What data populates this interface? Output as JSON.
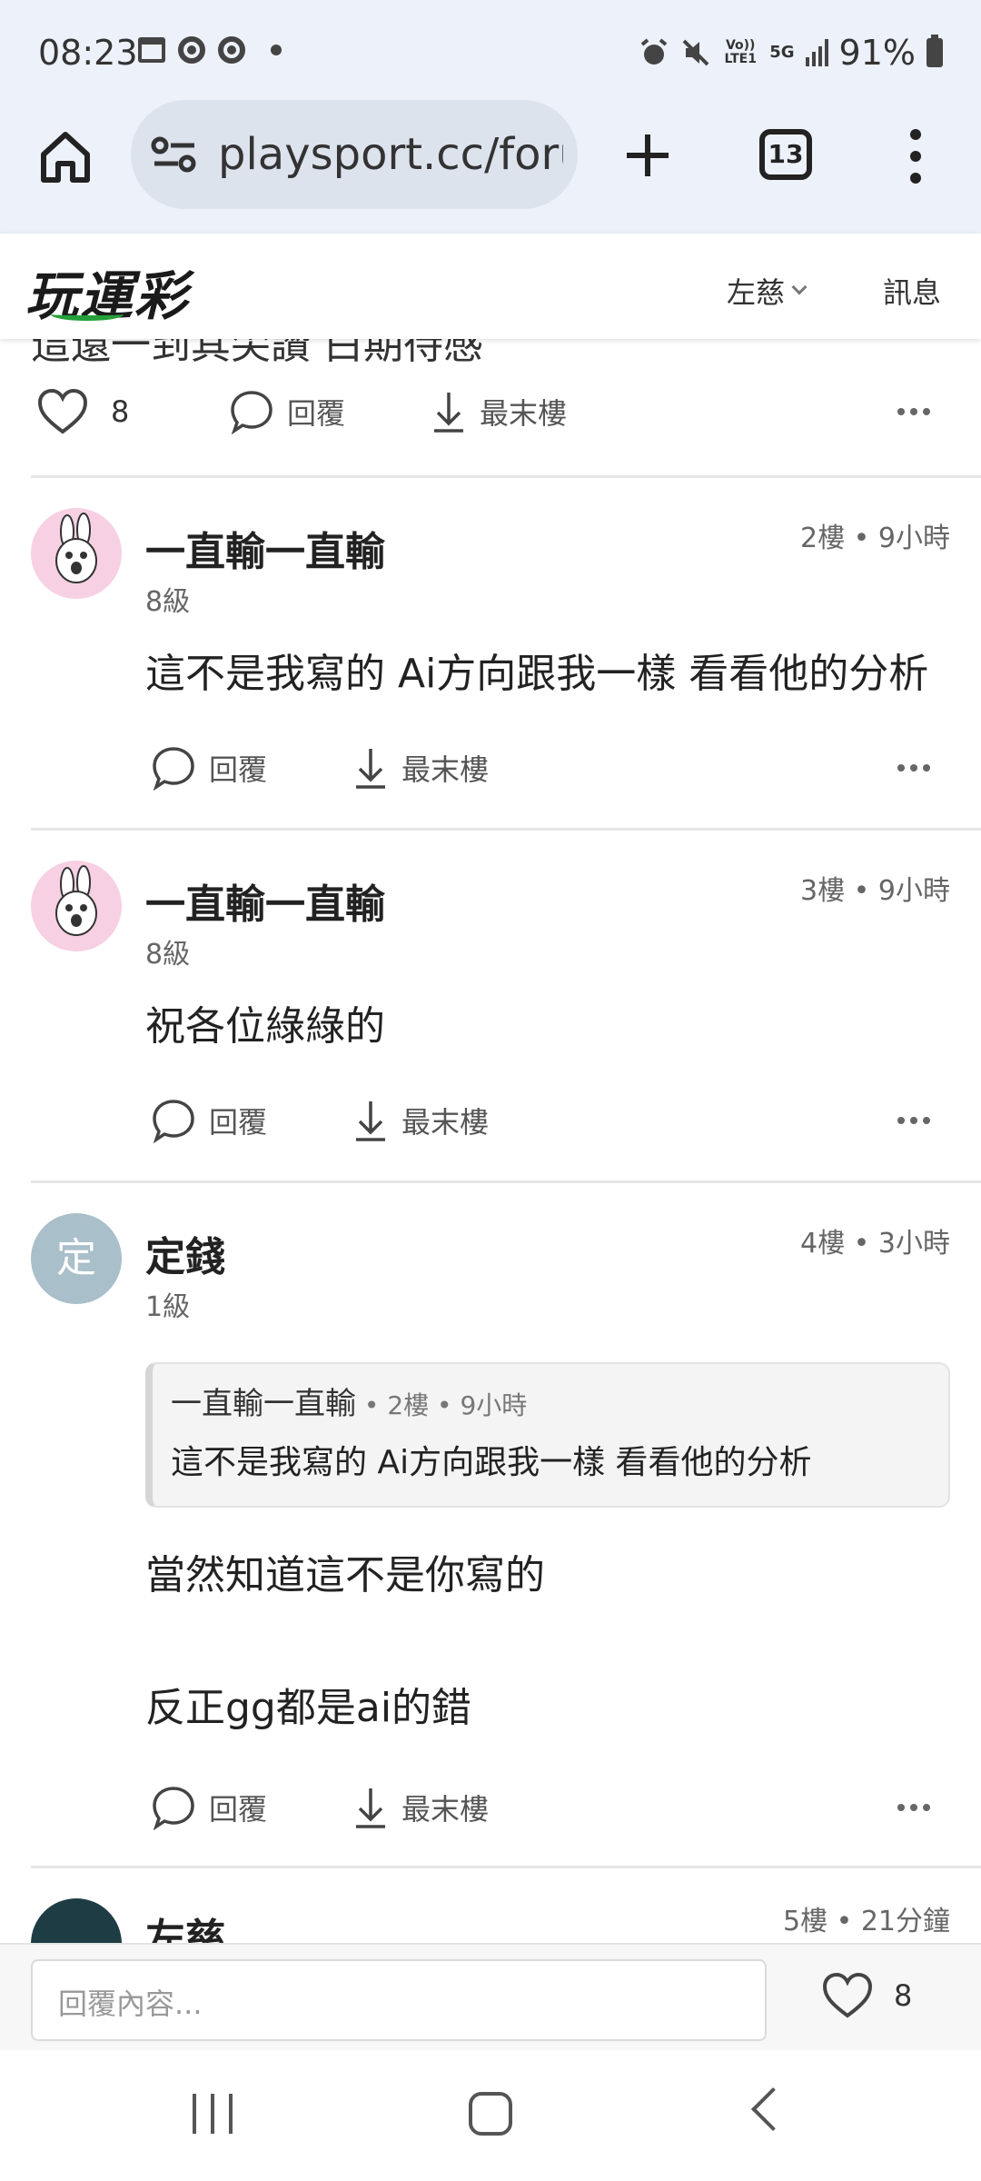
{
  "status_bar": {
    "time": "08:23",
    "battery": "91%",
    "network": "5G",
    "volte": "Vo)) LTE1",
    "icons_left": [
      "calendar-icon",
      "chrome-icon",
      "chrome-icon",
      "dot-icon"
    ],
    "icons_right": [
      "alarm-icon",
      "mute-icon",
      "volte-icon",
      "5g-icon",
      "signal-icon",
      "battery-icon"
    ]
  },
  "browser": {
    "url": "playsport.cc/foru",
    "tab_count": "13"
  },
  "site_header": {
    "logo": "玩運彩",
    "user": "左慈",
    "messages": "訊息"
  },
  "content": {
    "truncated_top_text": "這還一到其尖讚 白期待感",
    "first_post_actions": {
      "like_count": "8",
      "reply": "回覆",
      "last_floor": "最末樓"
    },
    "posts": [
      {
        "username": "一直輸一直輸",
        "level": "8級",
        "floor_time": "2樓 • 9小時",
        "body": [
          "這不是我寫的 Ai方向跟我一樣 看看他的分析"
        ],
        "reply": "回覆",
        "last_floor": "最末樓"
      },
      {
        "username": "一直輸一直輸",
        "level": "8級",
        "floor_time": "3樓 • 9小時",
        "body": [
          "祝各位綠綠的"
        ],
        "reply": "回覆",
        "last_floor": "最末樓"
      },
      {
        "username": "定錢",
        "avatar_letter": "定",
        "level": "1級",
        "floor_time": "4樓 • 3小時",
        "quote": {
          "author": "一直輸一直輸",
          "meta": " • 2樓 • 9小時",
          "text": "這不是我寫的 Ai方向跟我一樣 看看他的分析"
        },
        "body": [
          "當然知道這不是你寫的",
          "反正gg都是ai的錯"
        ],
        "reply": "回覆",
        "last_floor": "最末樓"
      },
      {
        "username": "左慈",
        "floor_time": "5樓 • 21分鐘"
      }
    ]
  },
  "reply_bar": {
    "placeholder": "回覆內容...",
    "like_count": "8"
  },
  "colors": {
    "chrome_bg": "#edf1f9",
    "omnibox_bg": "#dde3ed",
    "logo_green": "#26a03a",
    "avatar_letter_bg": "#a9bfc9",
    "avatar_rabbit_bg": "#f7d0e3"
  }
}
